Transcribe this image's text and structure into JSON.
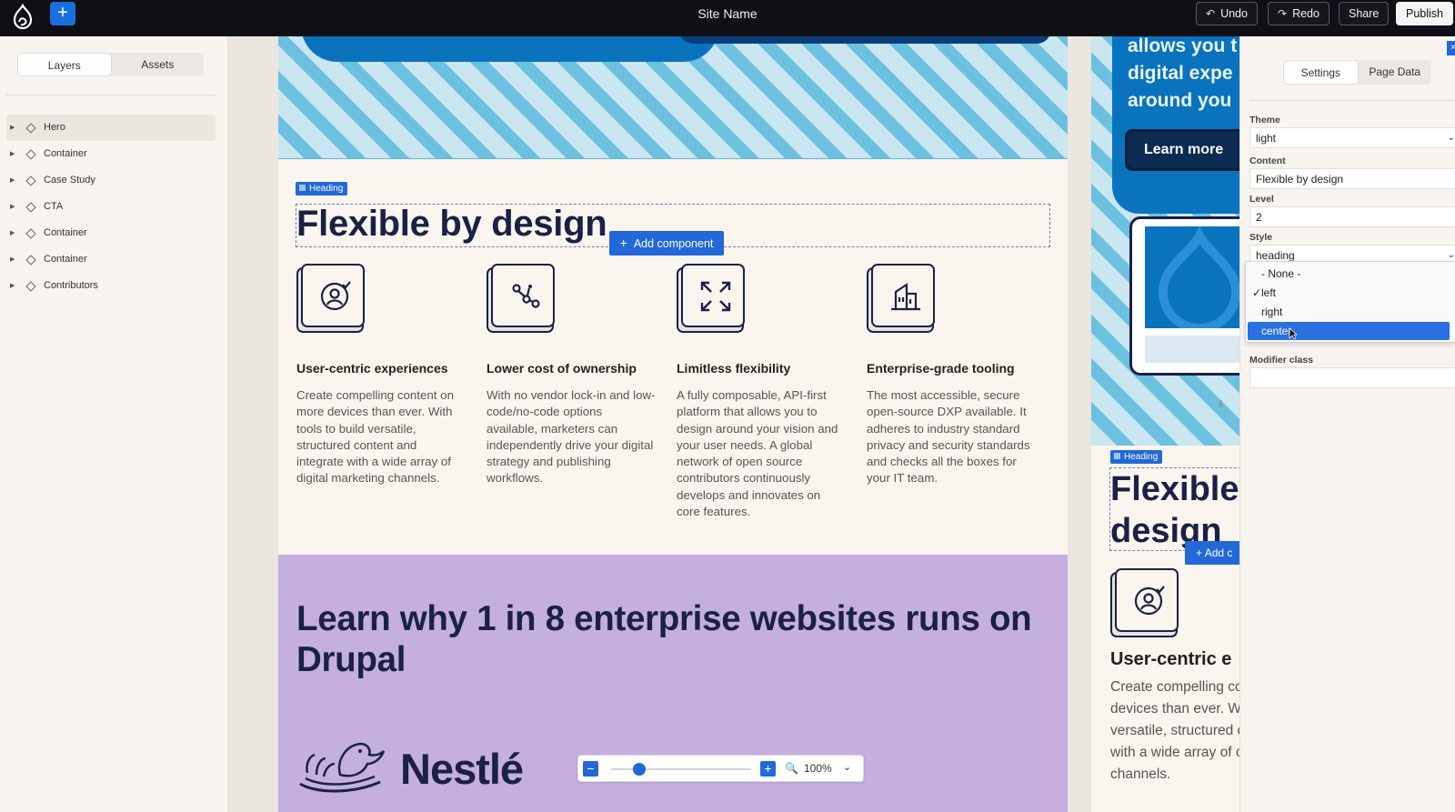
{
  "topbar": {
    "site_name": "Site Name",
    "undo_label": "Undo",
    "redo_label": "Redo",
    "share_label": "Share",
    "publish_label": "Publish",
    "add_label": "+"
  },
  "left_panel": {
    "tabs": [
      {
        "label": "Layers",
        "active": true
      },
      {
        "label": "Assets",
        "active": false
      }
    ],
    "layers": [
      "Hero",
      "Container",
      "Case Study",
      "CTA",
      "Container",
      "Container",
      "Contributors"
    ]
  },
  "canvas": {
    "heading_tag": "Heading",
    "heading": "Flexible by design",
    "add_component": "Add component",
    "features": [
      {
        "title": "User-centric experiences",
        "desc": "Create compelling content on more devices than ever. With tools to build versatile, structured content and integrate with a wide array of digital marketing channels.",
        "icon": "user-target-icon"
      },
      {
        "title": "Lower cost of ownership",
        "desc": "With no vendor lock-in and low-code/no-code options available, marketers can independently drive your digital strategy and publishing workflows.",
        "icon": "nodes-graph-icon"
      },
      {
        "title": "Limitless flexibility",
        "desc": "A fully composable, API-first platform that allows you to design around your vision and your user needs. A global network of open source contributors continuously develops and innovates on core features.",
        "icon": "expand-arrows-icon"
      },
      {
        "title": "Enterprise-grade tooling",
        "desc": "The most accessible, secure open-source DXP available. It adheres to industry standard privacy and security standards and checks all the boxes for your IT team.",
        "icon": "buildings-icon"
      }
    ],
    "cta_heading": "Learn why 1 in 8 enterprise websites runs on Drupal",
    "logo_text": "Nestlé",
    "zoom": {
      "level": 0.2,
      "label": "100%"
    }
  },
  "mobile": {
    "hero_text": [
      "allows you t",
      "digital expe",
      "around you"
    ],
    "learn_more": "Learn more",
    "heading_tag": "Heading",
    "heading_lines": [
      "Flexible",
      "design"
    ],
    "add_label": "Add c",
    "feature_title": "User-centric e",
    "feature_desc": [
      "Create compelling co",
      "devices than ever. Wi",
      "versatile, structured c",
      "with a wide array of c",
      "channels."
    ]
  },
  "right_panel": {
    "tabs": [
      {
        "label": "Settings",
        "active": true
      },
      {
        "label": "Page Data",
        "active": false
      }
    ],
    "theme_label": "Theme",
    "theme_value": "light",
    "content_label": "Content",
    "content_value": "Flexible by design",
    "level_label": "Level",
    "level_value": "2",
    "style_label": "Style",
    "style_value": "heading",
    "dropdown": [
      {
        "label": "- None -",
        "checked": false,
        "highlighted": false
      },
      {
        "label": "left",
        "checked": true,
        "highlighted": false
      },
      {
        "label": "right",
        "checked": false,
        "highlighted": false
      },
      {
        "label": "center",
        "checked": false,
        "highlighted": true
      }
    ],
    "modifier_label": "Modifier class",
    "modifier_value": ""
  },
  "colors": {
    "accent": "#2368d8",
    "navy": "#1b2145",
    "purple": "#c5afe0",
    "stripe_light": "#c9e6f1",
    "stripe_dark": "#6cc0e0"
  }
}
